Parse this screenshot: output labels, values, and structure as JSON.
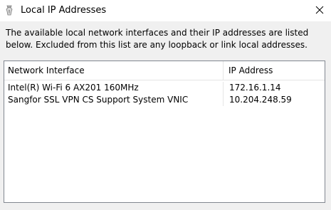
{
  "window": {
    "title": "Local IP Addresses",
    "icon": "app-icon",
    "close_icon": "close-icon"
  },
  "description": {
    "line1": "The available local network interfaces and their IP addresses are listed",
    "line2": "below.  Excluded from this list are any loopback or link local addresses."
  },
  "table": {
    "columns": [
      "Network Interface",
      "IP Address"
    ],
    "rows": [
      {
        "interface": "Intel(R) Wi-Fi 6 AX201 160MHz",
        "ip": "172.16.1.14"
      },
      {
        "interface": "Sangfor SSL VPN CS Support System VNIC",
        "ip": "10.204.248.59"
      }
    ]
  }
}
